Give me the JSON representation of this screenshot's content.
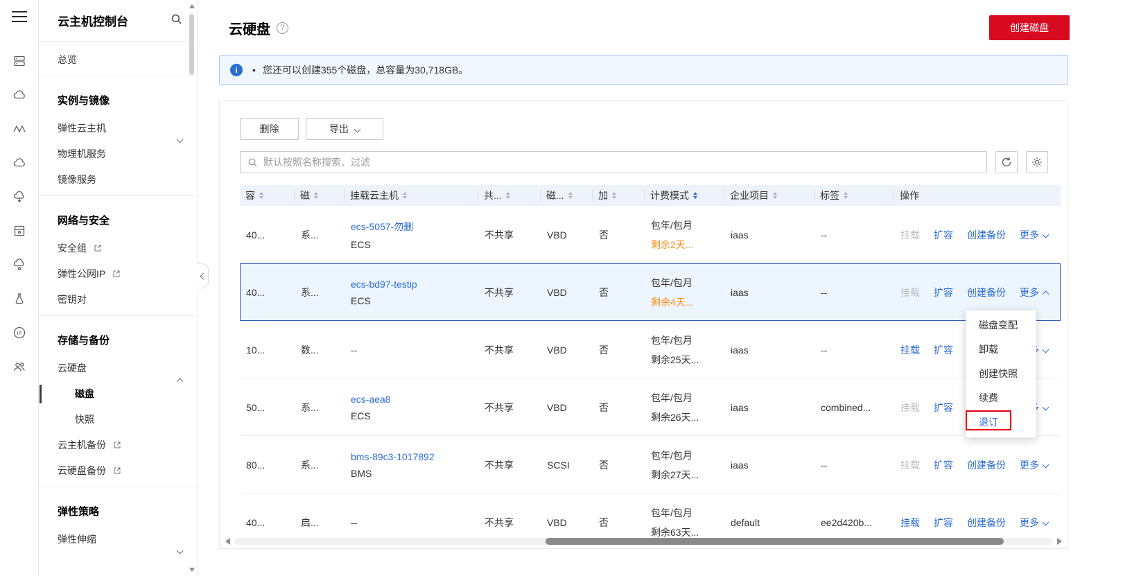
{
  "rail": {
    "icons": [
      "server-stack",
      "cloud",
      "waveform",
      "cloud-outline",
      "cloud-download",
      "storage-box",
      "cloud-link",
      "flask",
      "ip",
      "user-group"
    ]
  },
  "sidebar": {
    "title": "云主机控制台",
    "items": {
      "overview": "总览",
      "section_instances": "实例与镜像",
      "ecs": "弹性云主机",
      "physical": "物理机服务",
      "image": "镜像服务",
      "section_network": "网络与安全",
      "security_group": "安全组",
      "eip": "弹性公网IP",
      "keypair": "密钥对",
      "section_storage": "存储与备份",
      "evs": "云硬盘",
      "disk": "磁盘",
      "snapshot": "快照",
      "server_backup": "云主机备份",
      "disk_backup": "云硬盘备份",
      "section_policy": "弹性策略",
      "autoscaling": "弹性伸缩"
    }
  },
  "header": {
    "title": "云硬盘",
    "create_button": "创建磁盘"
  },
  "banner": {
    "message": "您还可以创建355个磁盘，总容量为30,718GB。"
  },
  "toolbar": {
    "delete": "删除",
    "export": "导出"
  },
  "search": {
    "placeholder": "默认按照名称搜索、过滤"
  },
  "table": {
    "columns": [
      "容",
      "磁",
      "挂载云主机",
      "共...",
      "磁...",
      "加",
      "计费模式",
      "企业项目",
      "标签",
      "操作"
    ],
    "action_labels": {
      "attach": "挂载",
      "expand": "扩容",
      "backup": "创建备份",
      "more": "更多"
    },
    "rows": [
      {
        "size": "40...",
        "attr": "系...",
        "server": "ecs-5057-勿删",
        "server_type": "ECS",
        "shared": "不共享",
        "mode": "VBD",
        "encrypted": "否",
        "billing": "包年/包月",
        "remaining": "剩余2天...",
        "project": "iaas",
        "tag": "--"
      },
      {
        "size": "40...",
        "attr": "系...",
        "server": "ecs-bd97-testip",
        "server_type": "ECS",
        "shared": "不共享",
        "mode": "VBD",
        "encrypted": "否",
        "billing": "包年/包月",
        "remaining": "剩余4天...",
        "project": "iaas",
        "tag": "--"
      },
      {
        "size": "10...",
        "attr": "数...",
        "server": "--",
        "server_type": "",
        "shared": "不共享",
        "mode": "VBD",
        "encrypted": "否",
        "billing": "包年/包月",
        "remaining": "剩余25天...",
        "project": "iaas",
        "tag": "--"
      },
      {
        "size": "50...",
        "attr": "系...",
        "server": "ecs-aea8",
        "server_type": "ECS",
        "shared": "不共享",
        "mode": "VBD",
        "encrypted": "否",
        "billing": "包年/包月",
        "remaining": "剩余26天...",
        "project": "iaas",
        "tag": "combined..."
      },
      {
        "size": "80...",
        "attr": "系...",
        "server": "bms-89c3-1017892",
        "server_type": "BMS",
        "shared": "不共享",
        "mode": "SCSI",
        "encrypted": "否",
        "billing": "包年/包月",
        "remaining": "剩余27天...",
        "project": "iaas",
        "tag": "--"
      },
      {
        "size": "40...",
        "attr": "启...",
        "server": "--",
        "server_type": "",
        "shared": "不共享",
        "mode": "VBD",
        "encrypted": "否",
        "billing": "包年/包月",
        "remaining": "剩余63天...",
        "project": "default",
        "tag": "ee2d420b..."
      }
    ]
  },
  "dropdown": {
    "items": [
      "磁盘变配",
      "卸载",
      "创建快照",
      "续费",
      "退订"
    ]
  },
  "colors": {
    "accent_red": "#d80a20",
    "link_blue": "#2b6cd4",
    "warning_orange": "#fa8c16",
    "selected_row_border": "#2f5bb7",
    "selected_row_bg": "#edf6ff",
    "banner_bg": "#f0f7ff",
    "table_header_bg": "#eef3fb",
    "annotation_red": "#e60012"
  }
}
